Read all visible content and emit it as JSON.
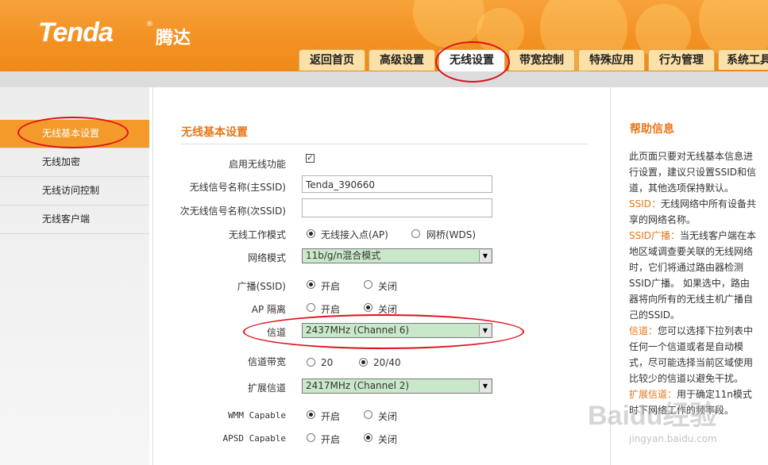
{
  "brand": {
    "logo": "Tenda",
    "reg": "®",
    "logo_cn": "腾达"
  },
  "tabs": [
    {
      "label": "返回首页"
    },
    {
      "label": "高级设置"
    },
    {
      "label": "无线设置"
    },
    {
      "label": "带宽控制"
    },
    {
      "label": "特殊应用"
    },
    {
      "label": "行为管理"
    },
    {
      "label": "系统工具"
    }
  ],
  "active_tab": "无线设置",
  "sidebar": {
    "items": [
      {
        "label": "无线基本设置"
      },
      {
        "label": "无线加密"
      },
      {
        "label": "无线访问控制"
      },
      {
        "label": "无线客户端"
      }
    ]
  },
  "main": {
    "title": "无线基本设置",
    "enable_label": "启用无线功能",
    "enable_checked": true,
    "ssid_label": "无线信号名称(主SSID)",
    "ssid_value": "Tenda_390660",
    "ssid2_label": "次无线信号名称(次SSID)",
    "ssid2_value": "",
    "mode_label": "无线工作模式",
    "mode_opt1": "无线接入点(AP)",
    "mode_opt2": "网桥(WDS)",
    "net_mode_label": "网络模式",
    "net_mode_value": "11b/g/n混合模式",
    "broadcast_label": "广播(SSID)",
    "on_label": "开启",
    "off_label": "关闭",
    "ap_isolation_label": "AP 隔离",
    "channel_label": "信道",
    "channel_value": "2437MHz (Channel 6)",
    "bandwidth_label": "信道带宽",
    "bw_opt1": "20",
    "bw_opt2": "20/40",
    "ext_channel_label": "扩展信道",
    "ext_channel_value": "2417MHz (Channel 2)",
    "wmm_label": "WMM Capable",
    "apsd_label": "APSD Capable"
  },
  "help": {
    "title": "帮助信息",
    "intro": "此页面只要对无线基本信息进行设置，建议只设置SSID和信道，其他选项保持默认。",
    "ssid_key": "SSID：",
    "ssid_text": "无线网络中所有设备共享的网络名称。",
    "bcast_key": "SSID广播：",
    "bcast_text": "当无线客户端在本地区域调查要关联的无线网络时，它们将通过路由器检测SSID广播。 如果选中，路由器将向所有的无线主机广播自己的SSID。",
    "channel_key": "信道：",
    "channel_text": "您可以选择下拉列表中任何一个信道或者是自动模式，尽可能选择当前区域使用比较少的信道以避免干扰。",
    "ext_key": "扩展信道：",
    "ext_text": "用于确定11n模式时下网络工作的频率段。"
  },
  "watermark": {
    "logo": "Baidu经验",
    "url": "jingyan.baidu.com"
  }
}
